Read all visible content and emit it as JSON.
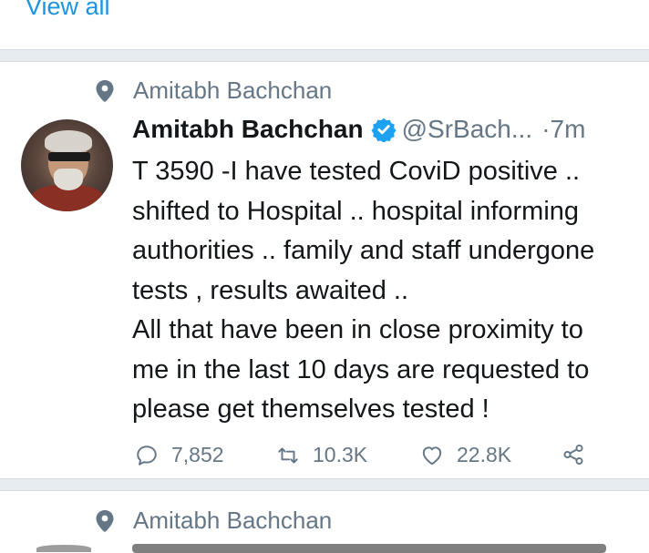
{
  "top_link": {
    "label": "View all"
  },
  "tweet": {
    "context_label": "Amitabh Bachchan",
    "author_name": "Amitabh Bachchan",
    "handle": "@SrBach...",
    "dot": "·",
    "time": "7m",
    "body_lines": [
      "T 3590 -I have tested CoviD positive ..",
      "shifted to Hospital  .. hospital informing",
      "authorities .. family and staff undergone",
      "tests , results awaited ..",
      "All that have been in close proximity to",
      "me in the last 10 days are requested to",
      "please get themselves tested !"
    ],
    "actions": {
      "reply_count": "7,852",
      "retweet_count": "10.3K",
      "like_count": "22.8K"
    },
    "icons": {
      "context": "location-pin-icon",
      "verified": "verified-badge-icon",
      "reply": "reply-icon",
      "retweet": "retweet-icon",
      "like": "heart-icon",
      "share": "share-icon"
    }
  },
  "next_tweet": {
    "context_label": "Amitabh Bachchan"
  },
  "colors": {
    "link_blue": "#1b95e0",
    "verified_blue": "#1da1f2",
    "muted_gray": "#657786",
    "divider_gray": "#e6ecf0"
  }
}
